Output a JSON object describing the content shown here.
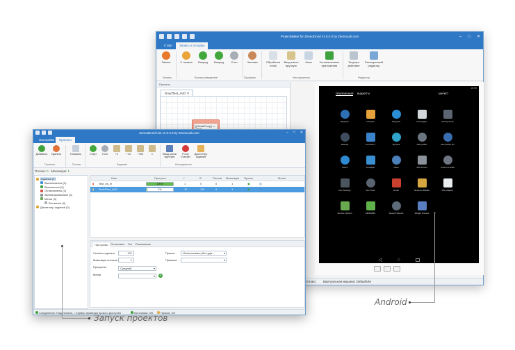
{
  "projectmaker": {
    "title": "ProjectMaker for ZennoDroid v1.0.0.0 by ZennoLab.com",
    "tabs": [
      "Старт",
      "Запись и отладка"
    ],
    "ribbon": {
      "record": "Запись",
      "from_start": "С начала",
      "forward1": "Вперед",
      "forward2": "Вперед",
      "stop": "Стоп",
      "human": "Человек",
      "email": "Обработка email",
      "captcha": "Ввод капчи вручную",
      "windows": "Окна",
      "install": "Установленные приложения",
      "current_action": "Текущее действие",
      "advanced_editor": "Расширенный редактор",
      "group_record": "Запись",
      "group_play": "Воспроизведение",
      "group_profile": "Профиль",
      "group_tools": "Инструменты",
      "group_editor": "Редактор"
    },
    "projects_header": "Проекты",
    "project_tab": "DroidTest_AVD",
    "node_text": "{{GlobalProxy}} == \"True\"",
    "status": "Готово.",
    "vm": "Виртуальная машина: DefaultVM"
  },
  "android": {
    "time": "15:59",
    "tabs": [
      "ПРИЛОЖЕНИЯ",
      "ВИДЖЕТЫ",
      "МАРКЕТ"
    ],
    "apps": [
      {
        "name": "Браузер",
        "color": "#2d6fb5",
        "round": true
      },
      {
        "name": "Галерея",
        "color": "#e5a13a",
        "round": false
      },
      {
        "name": "Загрузки",
        "color": "#2b8fd6",
        "round": true
      },
      {
        "name": "Календарь",
        "color": "#d2d6da",
        "round": false
      },
      {
        "name": "Калькулятор",
        "color": "#5b6470",
        "round": false
      },
      {
        "name": "Камера",
        "color": "#3e4d5e",
        "round": true
      },
      {
        "name": "Контакты",
        "color": "#3a82c9",
        "round": false
      },
      {
        "name": "Музыка",
        "color": "#2fa3c9",
        "round": true
      },
      {
        "name": "Настройки",
        "color": "#6b7580",
        "round": true
      },
      {
        "name": "Настройки Go",
        "color": "#3a6db0",
        "round": true
      },
      {
        "name": "Поиск",
        "color": "#2e8bd1",
        "round": true
      },
      {
        "name": "Телефон",
        "color": "#3a8fd0",
        "round": false
      },
      {
        "name": "Часы",
        "color": "#4a7fb8",
        "round": true
      },
      {
        "name": "API Demos",
        "color": "#8a9199",
        "round": false
      },
      {
        "name": "Custom Locale",
        "color": "#6d7680",
        "round": true
      },
      {
        "name": "Dev Settings",
        "color": "#4b5560",
        "round": false
      },
      {
        "name": "Dev Tools",
        "color": "#5a6470",
        "round": true
      },
      {
        "name": "Email",
        "color": "#c9402f",
        "round": false
      },
      {
        "name": "Gestures Builder",
        "color": "#d6a640",
        "round": false
      },
      {
        "name": "Play Маркет",
        "color": "#e9ecef",
        "round": false
      },
      {
        "name": "Service Options",
        "color": "#6aa84f",
        "round": false
      },
      {
        "name": "SMS/MMS",
        "color": "#5fb14a",
        "round": false
      },
      {
        "name": "Speech Record",
        "color": "#5d6a78",
        "round": true
      },
      {
        "name": "Widget Preview",
        "color": "#5a7fc0",
        "round": false
      }
    ]
  },
  "zennodroid": {
    "title": "ZennoDroid Lite v1.0.0.0 by ZennoLab.com",
    "tabs": [
      "Настройки",
      "Проекты"
    ],
    "ribbon": {
      "add": "Добавить",
      "remove": "Удалить",
      "show": "Показать",
      "start": "Старт",
      "stop": "Стоп",
      "p1": "+1",
      "p10": "+10",
      "p100": "+100",
      "inf": "∞",
      "captcha": "Ввод капчи вручную",
      "proxy": "Proxy Checker",
      "scheduler": "Диспетчер заданий",
      "group_projects": "Проекты",
      "group_threads": "Потоки",
      "group_task": "Задание",
      "group_tools": "Инструменты"
    },
    "threads_label": "Потоки:",
    "threads_value": "0",
    "max_label": "Максимум:",
    "max_value": "1",
    "tree": [
      {
        "label": "Задания (2)",
        "level": 0,
        "color": "#e0a93b",
        "selected": true
      },
      {
        "label": "Выполняются (0)",
        "level": 1,
        "color": "#3f8fd8",
        "selected": false
      },
      {
        "label": "Выполнены (0)",
        "level": 1,
        "color": "#3fa23f",
        "selected": false
      },
      {
        "label": "Остановлены (2)",
        "level": 1,
        "color": "#d9534f",
        "selected": false
      },
      {
        "label": "Запланированные (0)",
        "level": 1,
        "color": "#8a8f95",
        "selected": false
      },
      {
        "label": "Метки (0)",
        "level": 1,
        "color": "#6aa84f",
        "selected": false
      },
      {
        "label": "Без метки (0)",
        "level": 2,
        "color": "#aab1b8",
        "selected": false
      },
      {
        "label": "Диспетчер заданий (0)",
        "level": 0,
        "color": "#e0a93b",
        "selected": false
      }
    ],
    "grid": {
      "headers": [
        "Имя",
        "Прогресс",
        "✓",
        "↻",
        "Потоки",
        "Максимум",
        "Прокси",
        "Метки"
      ],
      "rows": [
        {
          "name": "Test_bs_ie",
          "progress": 1.0,
          "progress_label": "100%",
          "done": "1",
          "retry": "0",
          "threads": "0",
          "max": "1",
          "selected": false
        },
        {
          "name": "DroidTest_AVD",
          "progress": 0.01,
          "progress_label": "1%",
          "done": "12",
          "retry": "101",
          "threads": "0",
          "max": "1",
          "selected": true
        }
      ]
    },
    "props": {
      "tabs": [
        "Настройки",
        "Остановка",
        "Лог",
        "Расписание"
      ],
      "execute_label": "Сколько сделать",
      "execute_value": "101",
      "max_threads_label": "Максимум потоков",
      "max_threads_value": "1",
      "priority_label": "Приоритет",
      "priority_value": "Средний",
      "tags_label": "Метки",
      "tags_value": "",
      "proxy_label": "Прокси",
      "proxy_value": "Использовать (без уда...",
      "rules_label": "Правила",
      "rules_value": ""
    },
    "status": {
      "conn": "Соединение: Подключено. / Сервер проверки прокси: Доступен",
      "sources": "Источники: 0/0",
      "proxies": "Прокси: 0/0"
    }
  },
  "callouts": {
    "android": "Android",
    "projects": "Запуск проектов"
  }
}
